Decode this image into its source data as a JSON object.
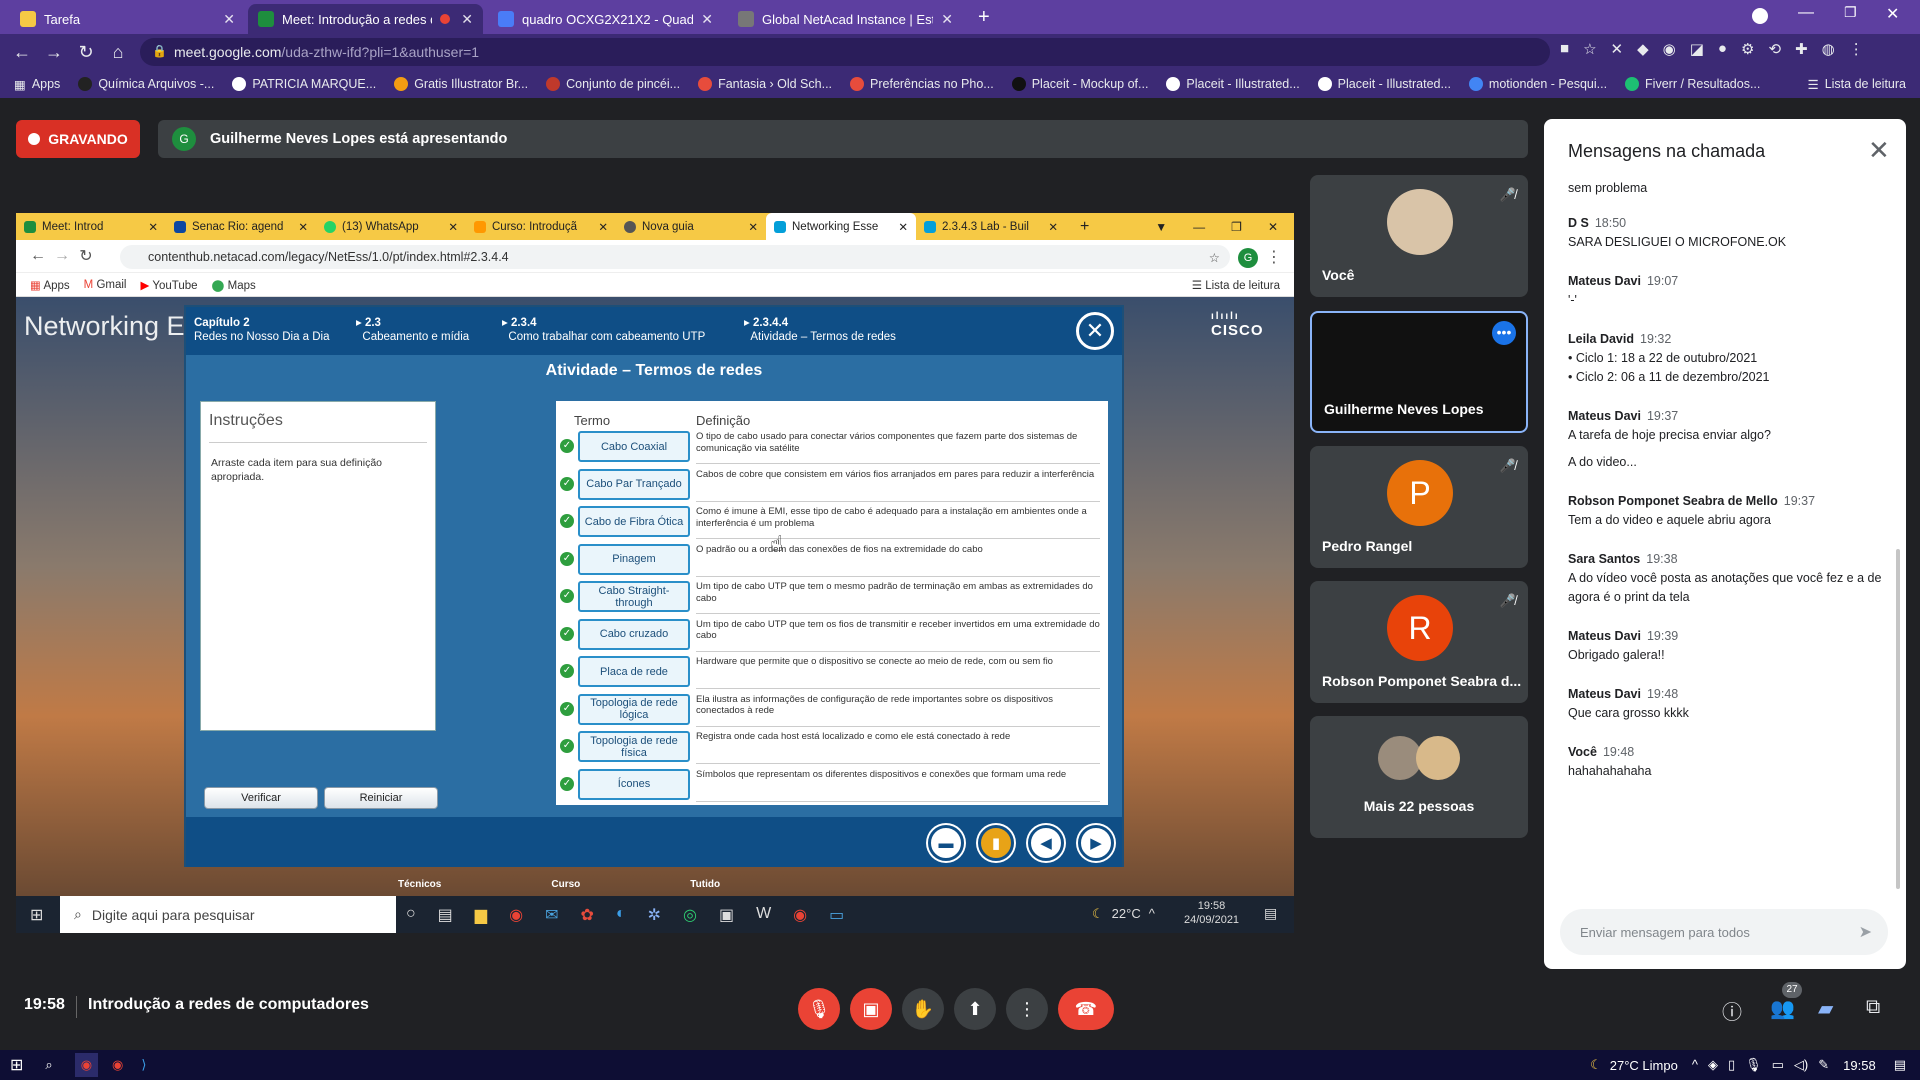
{
  "outer_tabs": [
    {
      "label": "Tarefa",
      "color": "#f6c945"
    },
    {
      "label": "Meet: Introdução a redes de",
      "color": "#1e8e3e"
    },
    {
      "label": "quadro OCXG2X21X2 - Quadro F",
      "color": "#4a7cf7"
    },
    {
      "label": "Global NetAcad Instance | Estou",
      "color": "#777777"
    }
  ],
  "url": {
    "host": "meet.google.com",
    "path": "/uda-zthw-ifd?pli=1&authuser=1"
  },
  "bookmarks": [
    "Apps",
    "Química Arquivos -...",
    "PATRICIA MARQUE...",
    "Gratis Illustrator Br...",
    "Conjunto de pincéi...",
    "Fantasia › Old Sch...",
    "Preferências no Pho...",
    "Placeit - Mockup of...",
    "Placeit - Illustrated...",
    "Placeit - Illustrated...",
    "motionden - Pesqui...",
    "Fiverr / Resultados...",
    "Lista de leitura"
  ],
  "recording_label": "GRAVANDO",
  "presenter": {
    "initial": "G",
    "text": "Guilherme Neves Lopes está apresentando"
  },
  "shared": {
    "tabs": [
      "Meet: Introd",
      "Senac Rio: agend",
      "(13) WhatsApp",
      "Curso: Introduçã",
      "Nova guia",
      "Networking Esse",
      "2.3.4.3 Lab - Buil"
    ],
    "url": "contenthub.netacad.com/legacy/NetEss/1.0/pt/index.html#2.3.4.4",
    "bookmarks": [
      "Apps",
      "Gmail",
      "YouTube",
      "Maps",
      "Lista de leitura"
    ],
    "page_title": "Networking E",
    "cisco": "CISCO",
    "breadcrumb": [
      {
        "l1": "Capítulo 2",
        "l2": "Redes no Nosso Dia a Dia"
      },
      {
        "l1": "2.3",
        "l2": "Cabeamento e mídia"
      },
      {
        "l1": "2.3.4",
        "l2": "Como trabalhar com cabeamento UTP"
      },
      {
        "l1": "2.3.4.4",
        "l2": "Atividade – Termos de redes"
      }
    ],
    "activity_title": "Atividade – Termos de redes",
    "instructions_title": "Instruções",
    "instructions_text": "Arraste cada item para sua definição apropriada.",
    "verify_label": "Verificar",
    "reset_label": "Reiniciar",
    "term_header": "Termo",
    "def_header": "Definição",
    "rows": [
      {
        "term": "Cabo Coaxial",
        "def": "O tipo de cabo usado para conectar vários componentes que fazem parte dos sistemas de comunicação via satélite"
      },
      {
        "term": "Cabo Par Trançado",
        "def": "Cabos de cobre que consistem em vários fios arranjados em pares para reduzir a interferência"
      },
      {
        "term": "Cabo de Fibra Ótica",
        "def": "Como é imune à EMI, esse tipo de cabo é adequado para a instalação em ambientes onde a interferência é um problema"
      },
      {
        "term": "Pinagem",
        "def": "O padrão ou a ordem das conexões de fios na extremidade do cabo"
      },
      {
        "term": "Cabo Straight-through",
        "def": "Um tipo de cabo UTP que tem o mesmo padrão de terminação em ambas as extremidades do cabo"
      },
      {
        "term": "Cabo cruzado",
        "def": "Um tipo de cabo UTP que tem os fios de transmitir e receber invertidos em uma extremidade do cabo"
      },
      {
        "term": "Placa de rede",
        "def": "Hardware que permite que o dispositivo se conecte ao meio de rede, com ou sem fio"
      },
      {
        "term": "Topologia de rede lógica",
        "def": "Ela ilustra as informações de configuração de rede importantes sobre os dispositivos conectados à rede"
      },
      {
        "term": "Topologia de rede física",
        "def": "Registra onde cada host está localizado e como ele está conectado à rede"
      },
      {
        "term": "Ícones",
        "def": "Símbolos que representam os diferentes dispositivos e conexões que formam uma rede"
      }
    ],
    "taskbar": {
      "search": "Digite aqui para pesquisar",
      "temp": "22°C",
      "time": "19:58",
      "date": "24/09/2021"
    },
    "partial_labels": [
      "Técnicos",
      "Curso",
      "Tutido"
    ]
  },
  "participants": [
    {
      "name": "Você",
      "muted": true,
      "avatar_color": "#d9c4a8"
    },
    {
      "name": "Guilherme Neves Lopes",
      "muted": false,
      "avatar_color": "#111111"
    },
    {
      "name": "Pedro Rangel",
      "initial": "P",
      "muted": true,
      "avatar_color": "#e8710a"
    },
    {
      "name": "Robson Pomponet Seabra d...",
      "initial": "R",
      "muted": true,
      "avatar_color": "#e8430a"
    },
    {
      "name": "Mais 22 pessoas",
      "muted": false
    }
  ],
  "chat": {
    "title": "Mensagens na chamada",
    "top_text": "sem problema",
    "messages": [
      {
        "sender": "D S",
        "time": "18:50",
        "lines": [
          "SARA DESLIGUEI O MICROFONE.OK"
        ]
      },
      {
        "sender": "Mateus Davi",
        "time": "19:07",
        "lines": [
          "'-'"
        ]
      },
      {
        "sender": "Leila David",
        "time": "19:32",
        "lines": [
          "•     Ciclo 1: 18 a 22 de outubro/2021",
          "•     Ciclo 2: 06 a 11 de dezembro/2021"
        ]
      },
      {
        "sender": "Mateus Davi",
        "time": "19:37",
        "lines": [
          "A tarefa de hoje precisa enviar algo?",
          "",
          "A do video..."
        ]
      },
      {
        "sender": "Robson Pomponet Seabra de Mello",
        "time": "19:37",
        "lines": [
          "Tem a do video e aquele abriu agora"
        ]
      },
      {
        "sender": "Sara Santos",
        "time": "19:38",
        "lines": [
          "A do vídeo você posta as anotações que você fez e a de agora é o print da tela"
        ]
      },
      {
        "sender": "Mateus Davi",
        "time": "19:39",
        "lines": [
          "Obrigado galera!!"
        ]
      },
      {
        "sender": "Mateus Davi",
        "time": "19:48",
        "lines": [
          "Que cara grosso kkkk"
        ]
      },
      {
        "sender": "Você",
        "time": "19:48",
        "lines": [
          "hahahahahaha"
        ]
      }
    ],
    "input_placeholder": "Enviar mensagem para todos"
  },
  "bottom": {
    "time": "19:58",
    "meeting_title": "Introdução a redes de computadores",
    "people_count": "27"
  },
  "os_taskbar": {
    "weather": "27°C  Limpo",
    "time": "19:58"
  }
}
